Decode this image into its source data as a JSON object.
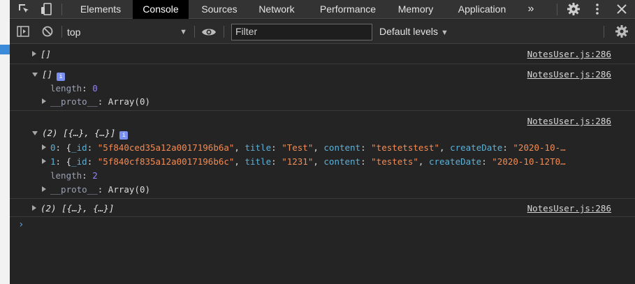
{
  "tabs": [
    "Elements",
    "Console",
    "Sources",
    "Network",
    "Performance",
    "Memory",
    "Application"
  ],
  "active_tab": "Console",
  "more_tabs": "»",
  "toolbar": {
    "context": "top",
    "filter_placeholder": "Filter",
    "levels": "Default levels"
  },
  "source": "NotesUser.js:286",
  "entries": {
    "e1": "[]",
    "e2": "[]",
    "e2_length_key": "length",
    "e2_length_val": "0",
    "e2_proto_key": "__proto__",
    "e2_proto_val": "Array(0)",
    "e3_head": "(2) [{…}, {…}]",
    "e3_item0": {
      "index": "0",
      "id_val": "\"5f840ced35a12a0017196b6a\"",
      "title_val": "\"Test\"",
      "content_val": "\"testetstest\"",
      "date_val": "\"2020-10-…"
    },
    "e3_item1": {
      "index": "1",
      "id_val": "\"5f840cf835a12a0017196b6c\"",
      "title_val": "\"1231\"",
      "content_val": "\"testets\"",
      "date_val": "\"2020-10-12T0…"
    },
    "e3_length_val": "2",
    "e4": "(2) [{…}, {…}]"
  },
  "field_names": {
    "id": "_id",
    "title": "title",
    "content": "content",
    "createDate": "createDate"
  },
  "prompt": "›",
  "colors": {
    "background": "#242424",
    "string": "#f28b54",
    "number": "#9980ff",
    "key": "#5db0d7",
    "active_tab": "#000000"
  }
}
